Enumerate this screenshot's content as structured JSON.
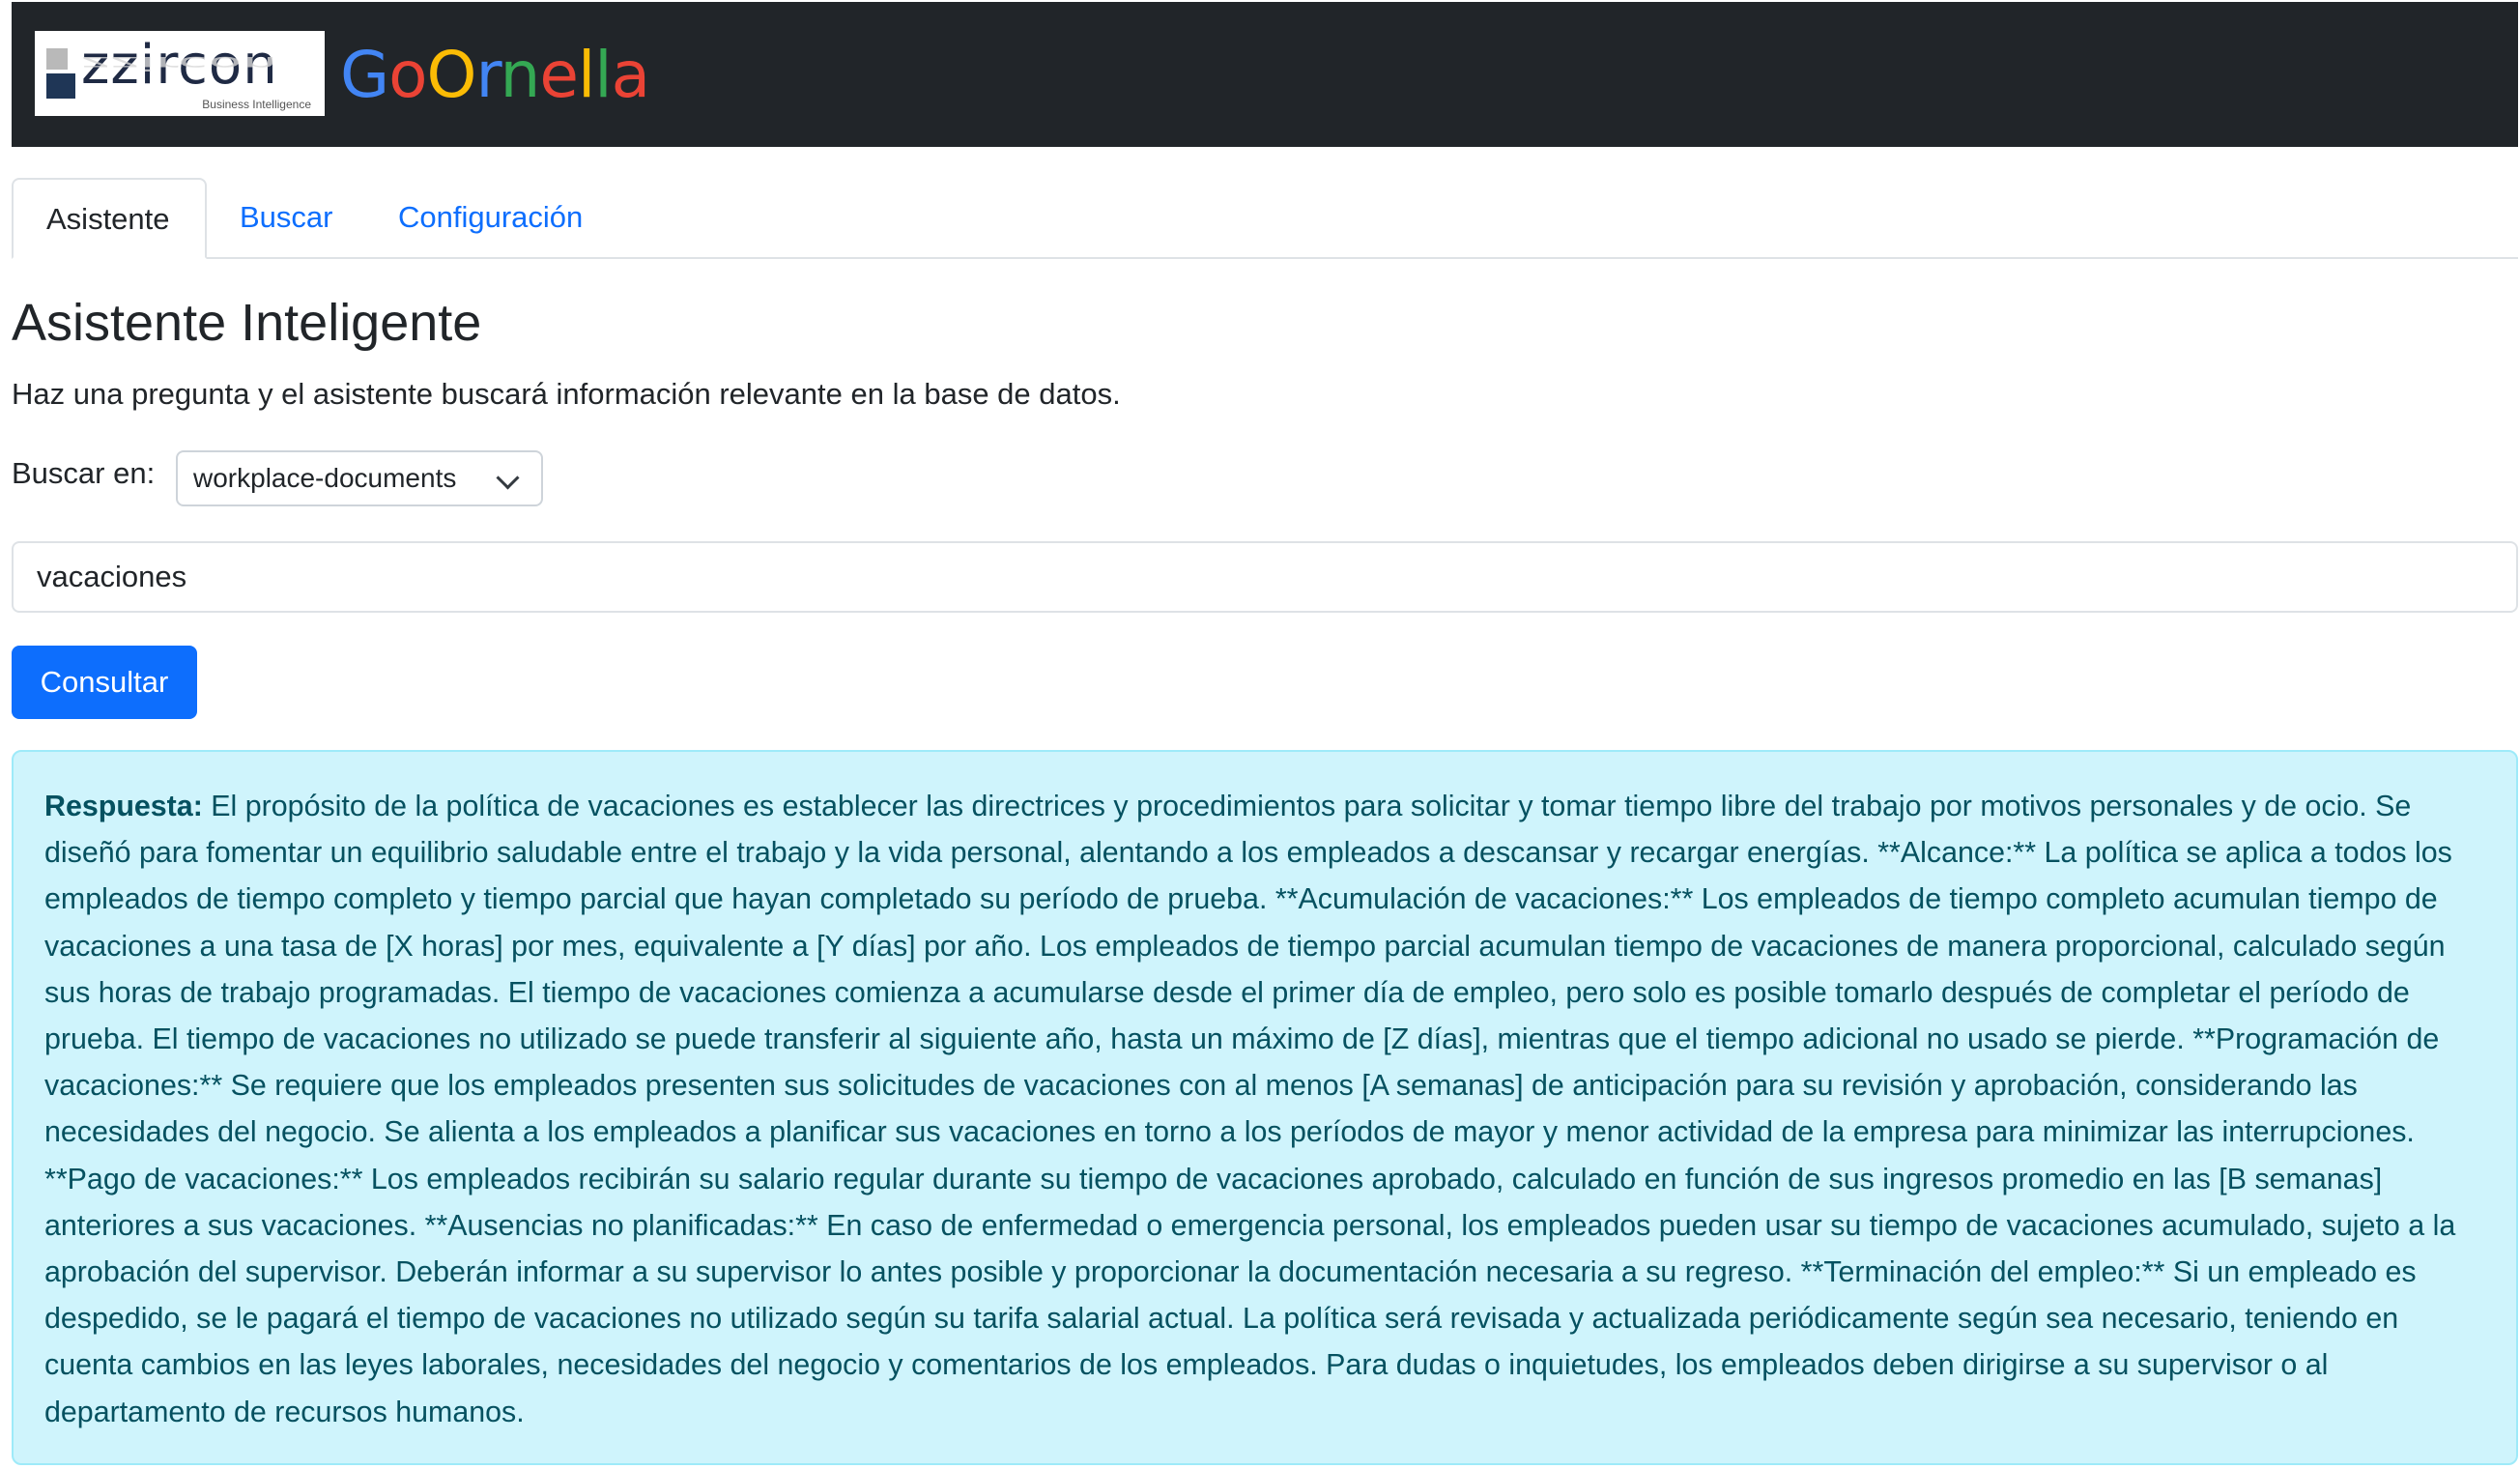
{
  "header": {
    "logo": {
      "word": "zzircon",
      "reflection": "zzircon",
      "tagline": "Business Intelligence"
    },
    "brand_letters": [
      {
        "ch": "G",
        "color": "#4285F4"
      },
      {
        "ch": "o",
        "color": "#EA4335"
      },
      {
        "ch": "O",
        "color": "#FBBC05"
      },
      {
        "ch": "r",
        "color": "#4285F4"
      },
      {
        "ch": "n",
        "color": "#34A853"
      },
      {
        "ch": "e",
        "color": "#EA4335"
      },
      {
        "ch": "l",
        "color": "#FBBC05"
      },
      {
        "ch": "l",
        "color": "#34A853"
      },
      {
        "ch": "a",
        "color": "#EA4335"
      }
    ]
  },
  "tabs": {
    "assistant": "Asistente",
    "search": "Buscar",
    "config": "Configuración",
    "active": "Asistente"
  },
  "main": {
    "title": "Asistente Inteligente",
    "subtitle": "Haz una pregunta y el asistente buscará información relevante en la base de datos.",
    "search_in_label": "Buscar en:",
    "index_selected": "workplace-documents",
    "query_value": "vacaciones",
    "submit_label": "Consultar"
  },
  "answer": {
    "label": "Respuesta:",
    "text": "El propósito de la política de vacaciones es establecer las directrices y procedimientos para solicitar y tomar tiempo libre del trabajo por motivos personales y de ocio. Se diseñó para fomentar un equilibrio saludable entre el trabajo y la vida personal, alentando a los empleados a descansar y recargar energías. **Alcance:** La política se aplica a todos los empleados de tiempo completo y tiempo parcial que hayan completado su período de prueba. **Acumulación de vacaciones:** Los empleados de tiempo completo acumulan tiempo de vacaciones a una tasa de [X horas] por mes, equivalente a [Y días] por año. Los empleados de tiempo parcial acumulan tiempo de vacaciones de manera proporcional, calculado según sus horas de trabajo programadas. El tiempo de vacaciones comienza a acumularse desde el primer día de empleo, pero solo es posible tomarlo después de completar el período de prueba. El tiempo de vacaciones no utilizado se puede transferir al siguiente año, hasta un máximo de [Z días], mientras que el tiempo adicional no usado se pierde. **Programación de vacaciones:** Se requiere que los empleados presenten sus solicitudes de vacaciones con al menos [A semanas] de anticipación para su revisión y aprobación, considerando las necesidades del negocio. Se alienta a los empleados a planificar sus vacaciones en torno a los períodos de mayor y menor actividad de la empresa para minimizar las interrupciones. **Pago de vacaciones:** Los empleados recibirán su salario regular durante su tiempo de vacaciones aprobado, calculado en función de sus ingresos promedio en las [B semanas] anteriores a sus vacaciones. **Ausencias no planificadas:** En caso de enfermedad o emergencia personal, los empleados pueden usar su tiempo de vacaciones acumulado, sujeto a la aprobación del supervisor. Deberán informar a su supervisor lo antes posible y proporcionar la documentación necesaria a su regreso. **Terminación del empleo:** Si un empleado es despedido, se le pagará el tiempo de vacaciones no utilizado según su tarifa salarial actual. La política será revisada y actualizada periódicamente según sea necesario, teniendo en cuenta cambios en las leyes laborales, necesidades del negocio y comentarios de los empleados. Para dudas o inquietudes, los empleados deben dirigirse a su supervisor o al departamento de recursos humanos."
  }
}
